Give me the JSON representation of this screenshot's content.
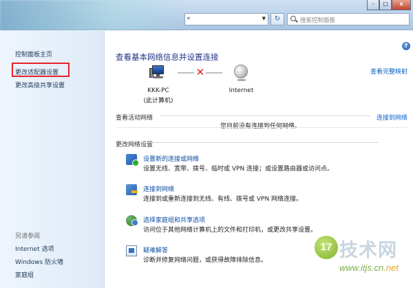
{
  "address_bar": {
    "dropdown_icon": "chevron-down-icon",
    "back_chevron": "«"
  },
  "refresh_icon": "refresh-icon",
  "search": {
    "placeholder": "搜索控制面板"
  },
  "window_controls": {
    "minimize": "-",
    "maximize": "□",
    "close": "x"
  },
  "sidebar": {
    "home": "控制面板主页",
    "adapter": "更改适配器设置",
    "sharing": "更改高级共享设置",
    "see_also": "另请参阅",
    "links": [
      "Internet 选项",
      "Windows 防火墙",
      "家庭组"
    ]
  },
  "main": {
    "help": "?",
    "title": "查看基本网络信息并设置连接",
    "full_map": "查看完整映射",
    "pc_name": "KKK-PC",
    "pc_sub": "(此计算机)",
    "internet": "Internet",
    "status_broken_symbol": "✕",
    "active_networks_header": "查看活动网络",
    "connect_to": "连接到网络",
    "no_connection": "您目前没有连接到任何网络。",
    "change_settings_header": "更改网络设置",
    "tasks": [
      {
        "title": "设置新的连接或网络",
        "desc": "设置无线、宽带、拨号、临时或 VPN 连接；或设置路由器或访问点。",
        "icon": "new-connection-icon"
      },
      {
        "title": "连接到网络",
        "desc": "连接到或重新连接到无线、有线、拨号或 VPN 网络连接。",
        "icon": "connect-network-icon"
      },
      {
        "title": "选择家庭组和共享选项",
        "desc": "访问位于其他网络计算机上的文件和打印机，或更改共享设置。",
        "icon": "homegroup-icon"
      },
      {
        "title": "疑难解答",
        "desc": "诊断并修复网络问题，或获得故障排除信息。",
        "icon": "troubleshoot-icon"
      }
    ]
  },
  "watermark": {
    "badge": "17",
    "text": "技术网",
    "url_prefix": "www.itjs.cn",
    "url_suffix": ".net"
  },
  "colors": {
    "link": "#0b63c6",
    "title": "#1e3287",
    "highlight_box": "#e5212a",
    "error_x": "#e01818"
  }
}
